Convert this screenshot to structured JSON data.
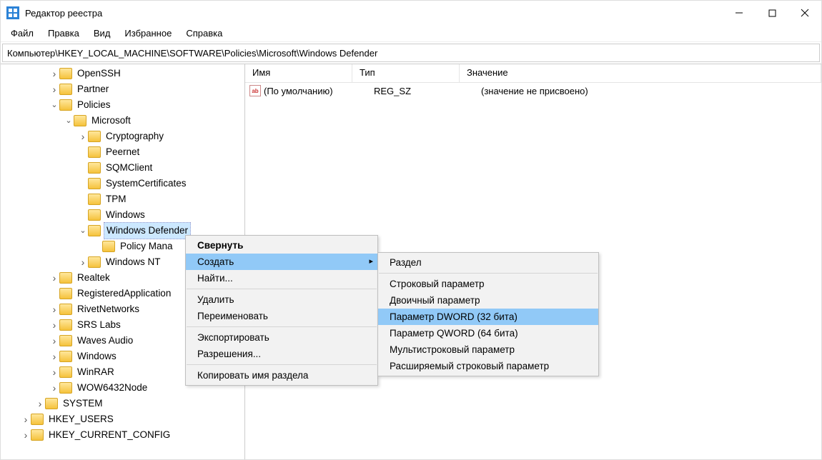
{
  "title": "Редактор реестра",
  "menu": {
    "file": "Файл",
    "edit": "Правка",
    "view": "Вид",
    "favorites": "Избранное",
    "help": "Справка"
  },
  "address": "Компьютер\\HKEY_LOCAL_MACHINE\\SOFTWARE\\Policies\\Microsoft\\Windows Defender",
  "tree": {
    "openssh": "OpenSSH",
    "partner": "Partner",
    "policies": "Policies",
    "microsoft": "Microsoft",
    "cryptography": "Cryptography",
    "peernet": "Peernet",
    "sqmclient": "SQMClient",
    "systemcertificates": "SystemCertificates",
    "tpm": "TPM",
    "windows": "Windows",
    "windowsdefender": "Windows Defender",
    "policymana": "Policy Mana",
    "windowsnt": "Windows NT",
    "realtek": "Realtek",
    "registeredapps": "RegisteredApplication",
    "rivetnetworks": "RivetNetworks",
    "srslabs": "SRS Labs",
    "wavesaudio": "Waves Audio",
    "windows2": "Windows",
    "winrar": "WinRAR",
    "wow6432": "WOW6432Node",
    "system": "SYSTEM",
    "hkeyusers": "HKEY_USERS",
    "hkeycurrentconfig": "HKEY_CURRENT_CONFIG"
  },
  "list": {
    "cols": {
      "name": "Имя",
      "type": "Тип",
      "value": "Значение"
    },
    "row0": {
      "name": "(По умолчанию)",
      "type": "REG_SZ",
      "value": "(значение не присвоено)"
    }
  },
  "ctx1": {
    "collapse": "Свернуть",
    "create": "Создать",
    "find": "Найти...",
    "delete": "Удалить",
    "rename": "Переименовать",
    "export": "Экспортировать",
    "permissions": "Разрешения...",
    "copykey": "Копировать имя раздела"
  },
  "ctx2": {
    "key": "Раздел",
    "string": "Строковый параметр",
    "binary": "Двоичный параметр",
    "dword": "Параметр DWORD (32 бита)",
    "qword": "Параметр QWORD (64 бита)",
    "multistring": "Мультистроковый параметр",
    "expstring": "Расширяемый строковый параметр"
  }
}
